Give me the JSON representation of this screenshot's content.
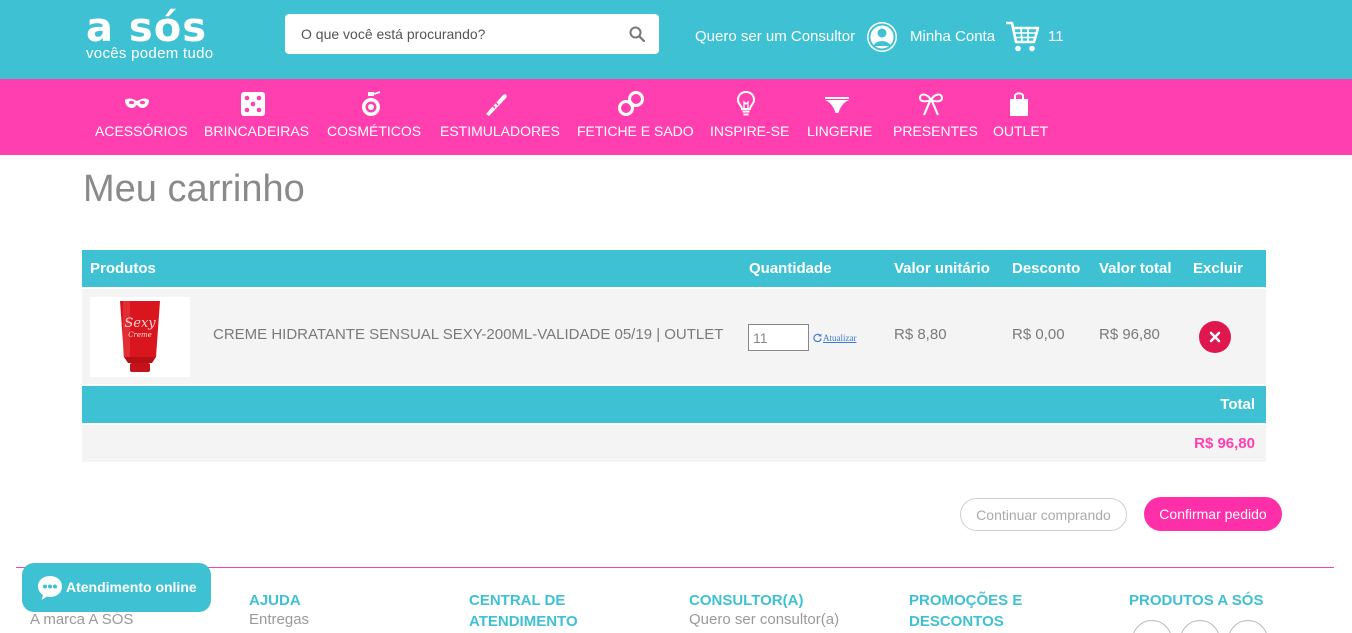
{
  "header": {
    "logo_main": "a sós",
    "logo_sub": "vocês podem tudo",
    "search_placeholder": "O que você está procurando?",
    "consultor_link": "Quero ser um Consultor",
    "account_link": "Minha Conta",
    "cart_count": "11"
  },
  "categories": [
    {
      "label": "ACESSÓRIOS",
      "icon": "mask-icon"
    },
    {
      "label": "BRINCADEIRAS",
      "icon": "dice-icon"
    },
    {
      "label": "COSMÉTICOS",
      "icon": "perfume-icon"
    },
    {
      "label": "ESTIMULADORES",
      "icon": "vibrator-icon"
    },
    {
      "label": "FETICHE E SADO",
      "icon": "handcuffs-icon"
    },
    {
      "label": "INSPIRE-SE",
      "icon": "lightbulb-icon"
    },
    {
      "label": "LINGERIE",
      "icon": "panties-icon"
    },
    {
      "label": "PRESENTES",
      "icon": "bow-icon"
    },
    {
      "label": "OUTLET",
      "icon": "shopping-bag-icon"
    }
  ],
  "cart": {
    "title": "Meu carrinho",
    "columns": {
      "produtos": "Produtos",
      "quantidade": "Quantidade",
      "valor_unitario": "Valor unitário",
      "desconto": "Desconto",
      "valor_total": "Valor total",
      "excluir": "Excluir"
    },
    "items": [
      {
        "name": "CREME HIDRATANTE SENSUAL SEXY-200ML-VALIDADE 05/19 | OUTLET",
        "quantity": "11",
        "update_label": "Atualizar",
        "unit_price": "R$ 8,80",
        "discount": "R$ 0,00",
        "total": "R$ 96,80"
      }
    ],
    "total_label": "Total",
    "total_value": "R$ 96,80",
    "continue_label": "Continuar comprando",
    "confirm_label": "Confirmar pedido"
  },
  "footer": {
    "chat_label": "Atendimento online",
    "col0_item": "A marca A SÓS",
    "columns": [
      {
        "title": "AJUDA",
        "item": "Entregas"
      },
      {
        "title": "CENTRAL DE ATENDIMENTO",
        "item": ""
      },
      {
        "title": "CONSULTOR(A)",
        "item": "Quero ser consultor(a)"
      },
      {
        "title": "PROMOÇÕES E DESCONTOS",
        "item": ""
      },
      {
        "title": "PRODUTOS A SÓS",
        "item": ""
      }
    ]
  },
  "colors": {
    "teal": "#3fc1d4",
    "pink": "#ff3fb0",
    "delete_red": "#e0174f"
  }
}
